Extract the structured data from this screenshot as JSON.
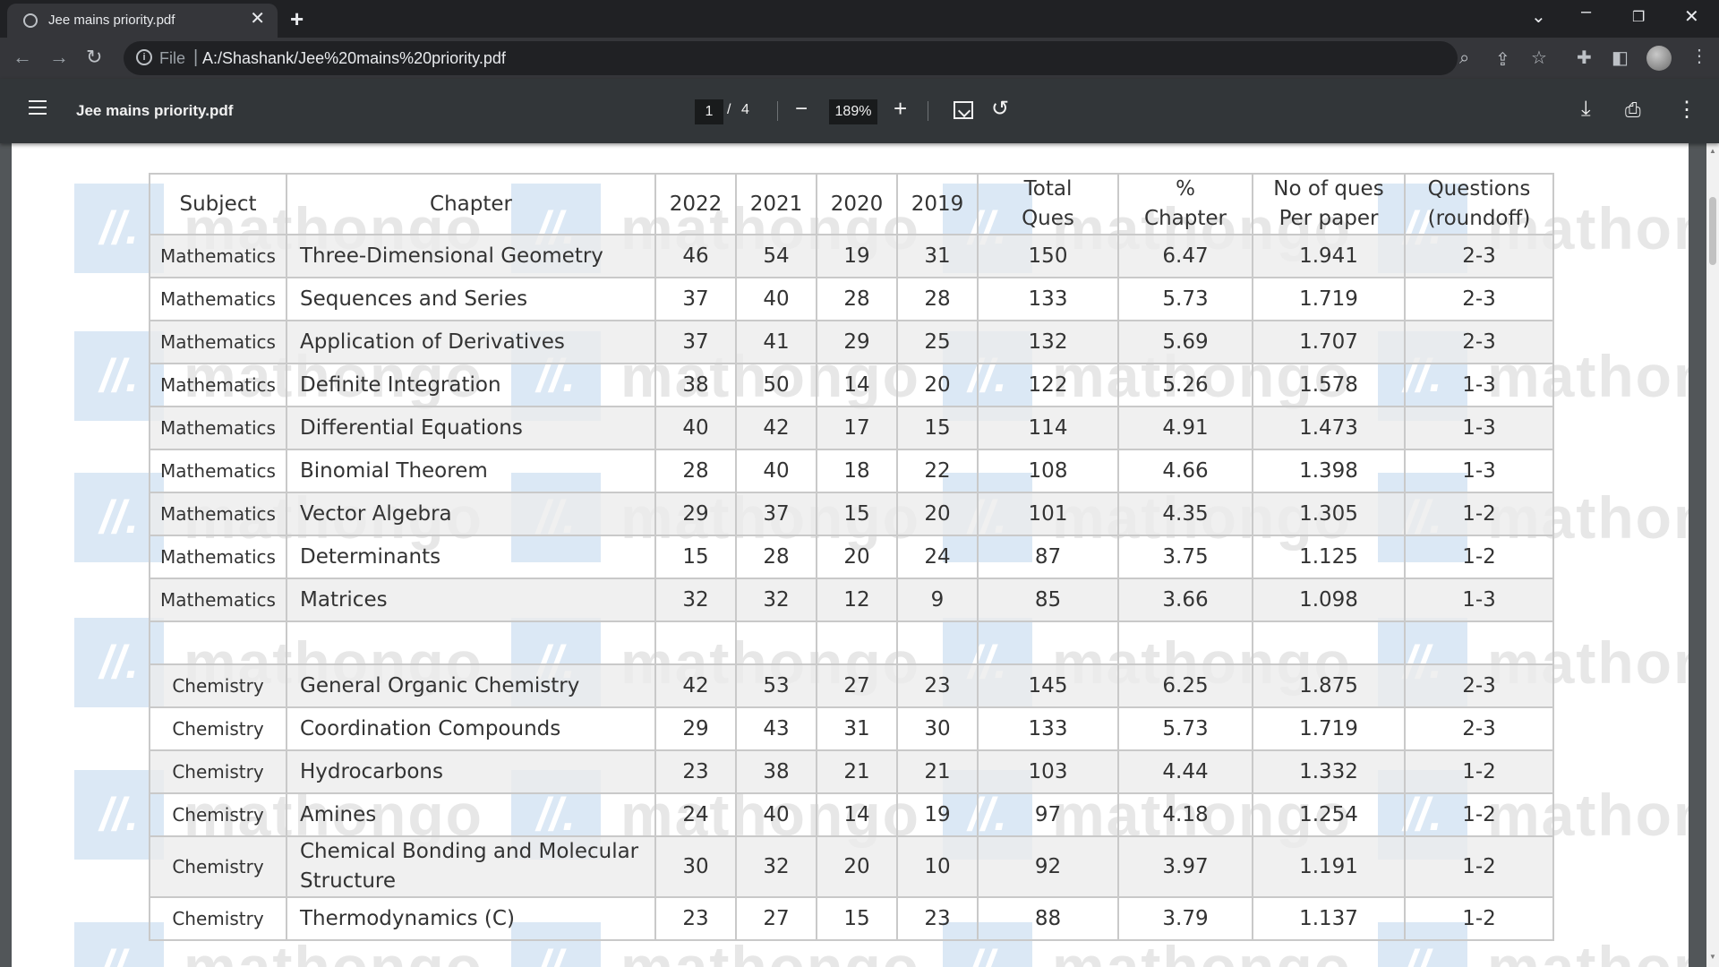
{
  "browser": {
    "tab_title": "Jee mains priority.pdf",
    "url_scheme_label": "File",
    "url": "A:/Shashank/Jee%20mains%20priority.pdf"
  },
  "pdf_toolbar": {
    "document_title": "Jee mains priority.pdf",
    "current_page": "1",
    "page_separator": "/",
    "total_pages": "4",
    "zoom": "189%"
  },
  "watermark": {
    "text": "mathongo",
    "logo_text": "//."
  },
  "table": {
    "headers": {
      "subject": "Subject",
      "chapter": "Chapter",
      "y2022": "2022",
      "y2021": "2021",
      "y2020": "2020",
      "y2019": "2019",
      "total_l1": "Total",
      "total_l2": "Ques",
      "pct_l1": "%",
      "pct_l2": "Chapter",
      "noq_l1": "No of ques",
      "noq_l2": "Per paper",
      "q_l1": "Questions",
      "q_l2": "(roundoff)"
    },
    "rows": [
      [
        "Mathematics",
        "Three-Dimensional Geometry",
        "46",
        "54",
        "19",
        "31",
        "150",
        "6.47",
        "1.941",
        "2-3"
      ],
      [
        "Mathematics",
        "Sequences and Series",
        "37",
        "40",
        "28",
        "28",
        "133",
        "5.73",
        "1.719",
        "2-3"
      ],
      [
        "Mathematics",
        "Application of Derivatives",
        "37",
        "41",
        "29",
        "25",
        "132",
        "5.69",
        "1.707",
        "2-3"
      ],
      [
        "Mathematics",
        "Definite Integration",
        "38",
        "50",
        "14",
        "20",
        "122",
        "5.26",
        "1.578",
        "1-3"
      ],
      [
        "Mathematics",
        "Differential Equations",
        "40",
        "42",
        "17",
        "15",
        "114",
        "4.91",
        "1.473",
        "1-3"
      ],
      [
        "Mathematics",
        "Binomial Theorem",
        "28",
        "40",
        "18",
        "22",
        "108",
        "4.66",
        "1.398",
        "1-3"
      ],
      [
        "Mathematics",
        "Vector Algebra",
        "29",
        "37",
        "15",
        "20",
        "101",
        "4.35",
        "1.305",
        "1-2"
      ],
      [
        "Mathematics",
        "Determinants",
        "15",
        "28",
        "20",
        "24",
        "87",
        "3.75",
        "1.125",
        "1-2"
      ],
      [
        "Mathematics",
        "Matrices",
        "32",
        "32",
        "12",
        "9",
        "85",
        "3.66",
        "1.098",
        "1-3"
      ],
      [
        "",
        "",
        "",
        "",
        "",
        "",
        "",
        "",
        "",
        ""
      ],
      [
        "Chemistry",
        "General Organic Chemistry",
        "42",
        "53",
        "27",
        "23",
        "145",
        "6.25",
        "1.875",
        "2-3"
      ],
      [
        "Chemistry",
        "Coordination Compounds",
        "29",
        "43",
        "31",
        "30",
        "133",
        "5.73",
        "1.719",
        "2-3"
      ],
      [
        "Chemistry",
        "Hydrocarbons",
        "23",
        "38",
        "21",
        "21",
        "103",
        "4.44",
        "1.332",
        "1-2"
      ],
      [
        "Chemistry",
        "Amines",
        "24",
        "40",
        "14",
        "19",
        "97",
        "4.18",
        "1.254",
        "1-2"
      ],
      [
        "Chemistry",
        "Chemical Bonding and Molecular Structure",
        "30",
        "32",
        "20",
        "10",
        "92",
        "3.97",
        "1.191",
        "1-2"
      ],
      [
        "Chemistry",
        "Thermodynamics (C)",
        "23",
        "27",
        "15",
        "23",
        "88",
        "3.79",
        "1.137",
        "1-2"
      ]
    ]
  }
}
